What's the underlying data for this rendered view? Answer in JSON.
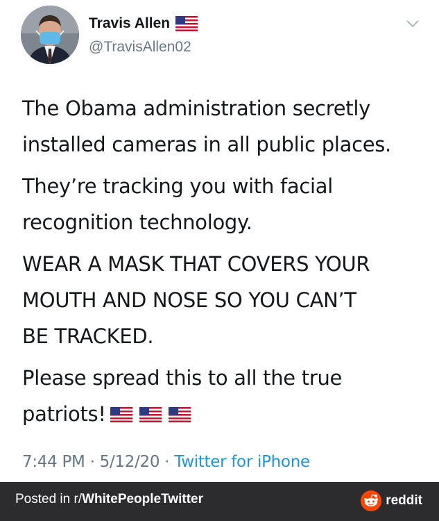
{
  "tweet": {
    "name": "Travis Allen",
    "handle": "@TravisAllen02",
    "paragraphs": [
      "The Obama administration secretly\ninstalled cameras in all public places.",
      "They’re tracking you with facial\nrecognition technology.",
      "WEAR A MASK THAT COVERS YOUR\nMOUTH AND NOSE SO YOU CAN’T\nBE TRACKED.",
      "Please spread this to all the true\npatriots!"
    ],
    "time": "7:44 PM",
    "date": "5/12/20",
    "source": "Twitter for iPhone"
  },
  "footer": {
    "posted_in": "Posted in r/",
    "subreddit": "WhitePeopleTwitter",
    "brand": "reddit"
  },
  "colors": {
    "text": "#14171a",
    "muted": "#657786",
    "link": "#1b95e0",
    "footer_bg": "#2c2c2e",
    "reddit_orange": "#ff4500"
  },
  "icons": [
    "us-flag-icon",
    "chevron-down-icon",
    "reddit-logo-icon"
  ]
}
